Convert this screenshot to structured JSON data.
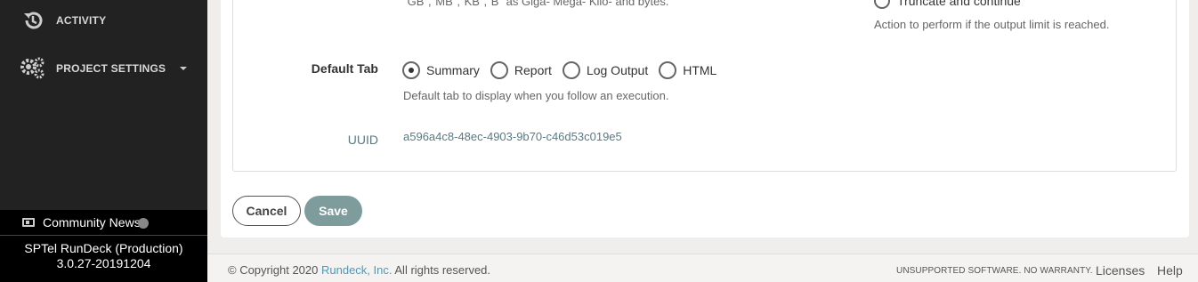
{
  "sidebar": {
    "items": [
      {
        "label": "ACTIVITY",
        "icon": "history-icon"
      },
      {
        "label": "PROJECT SETTINGS",
        "icon": "gears-icon"
      }
    ],
    "community_news": "Community News",
    "version": "SPTel RunDeck (Production) 3.0.27-20191204"
  },
  "form": {
    "size_help": "\"GB\",\"MB\",\"KB\",\"B\" as Giga- Mega- Kilo- and bytes.",
    "limit_action_option": "Truncate and continue",
    "limit_action_help": "Action to perform if the output limit is reached.",
    "default_tab": {
      "label": "Default Tab",
      "options": [
        "Summary",
        "Report",
        "Log Output",
        "HTML"
      ],
      "selected": "Summary",
      "help": "Default tab to display when you follow an execution."
    },
    "uuid": {
      "label": "UUID",
      "value": "a596a4c8-48ec-4903-9b70-c46d53c019e5"
    }
  },
  "buttons": {
    "cancel": "Cancel",
    "save": "Save"
  },
  "footer": {
    "copyright_prefix": "© Copyright 2020 ",
    "company_link": "Rundeck, Inc.",
    "copyright_suffix": " All rights reserved.",
    "unsupported": "UNSUPPORTED SOFTWARE. NO WARRANTY.",
    "licenses": "Licenses",
    "help": "Help"
  },
  "colors": {
    "sidebar_bg": "#222222",
    "save_button": "#7e9c9c",
    "link": "#4a9bb8",
    "uuid": "#5a7a85"
  }
}
